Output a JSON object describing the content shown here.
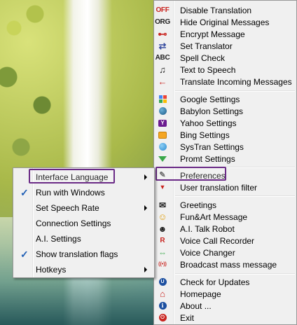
{
  "main_menu": {
    "group1": [
      {
        "label": "Disable Translation",
        "icon": "off-icon",
        "glyph": "OFF",
        "color": "#c9241f"
      },
      {
        "label": "Hide Original Messages",
        "icon": "org-icon",
        "glyph": "ORG",
        "color": "#222222"
      },
      {
        "label": "Encrypt Message",
        "icon": "key-icon",
        "glyph": "⊷",
        "color": "#c9241f"
      },
      {
        "label": "Set Translator",
        "icon": "swap-arrows-icon",
        "glyph": "⇄",
        "color": "#3a4fa0"
      },
      {
        "label": "Spell Check",
        "icon": "abc-icon",
        "glyph": "ABC",
        "color": "#222222"
      },
      {
        "label": "Text to Speech",
        "icon": "music-note-icon",
        "glyph": "♫",
        "color": "#222222"
      },
      {
        "label": "Translate Incoming Messages",
        "icon": "back-arrow-icon",
        "glyph": "←",
        "color": "#c9241f"
      }
    ],
    "group2": [
      {
        "label": "Google Settings",
        "icon": "google-icon",
        "color": "#4285f4"
      },
      {
        "label": "Babylon Settings",
        "icon": "babylon-icon",
        "color": "#1c5a86"
      },
      {
        "label": "Yahoo Settings",
        "icon": "yahoo-icon",
        "glyph": "Y",
        "color": "#6b1b8f"
      },
      {
        "label": "Bing Settings",
        "icon": "bing-icon",
        "color": "#f5a623"
      },
      {
        "label": "SysTran Settings",
        "icon": "systran-icon",
        "color": "#2a8ad0"
      },
      {
        "label": "Promt Settings",
        "icon": "promt-icon",
        "color": "#3aa84a"
      }
    ],
    "group3": [
      {
        "label": "Preferences",
        "icon": "wrench-icon",
        "glyph": "🔧",
        "color": "#555555"
      },
      {
        "label": "User translation filter",
        "icon": "filter-icon",
        "glyph": "▼",
        "color": "#c9241f"
      }
    ],
    "group4": [
      {
        "label": "Greetings",
        "icon": "envelope-icon",
        "glyph": "✉",
        "color": "#222222"
      },
      {
        "label": "Fun&Art Message",
        "icon": "smiley-icon",
        "glyph": "☺",
        "color": "#e0a010"
      },
      {
        "label": "A.I. Talk Robot",
        "icon": "robot-icon",
        "glyph": "☻",
        "color": "#333333"
      },
      {
        "label": "Voice Call Recorder",
        "icon": "record-icon",
        "glyph": "R",
        "color": "#c9241f"
      },
      {
        "label": "Voice Changer",
        "icon": "voice-changer-icon",
        "glyph": "⇔",
        "color": "#3aa84a"
      },
      {
        "label": "Broadcast mass message",
        "icon": "broadcast-icon",
        "glyph": "((•))",
        "color": "#c9241f"
      }
    ],
    "group5": [
      {
        "label": "Check for Updates",
        "icon": "update-icon",
        "glyph": "U",
        "color": "#1c4fa0"
      },
      {
        "label": "Homepage",
        "icon": "home-icon",
        "glyph": "⌂",
        "color": "#c9241f"
      },
      {
        "label": "About ...",
        "icon": "info-icon",
        "glyph": "i",
        "color": "#1c4fa0"
      },
      {
        "label": "Exit",
        "icon": "power-icon",
        "glyph": "⏻",
        "color": "#c9241f"
      }
    ]
  },
  "sub_menu": {
    "items": [
      {
        "label": "Interface Language",
        "has_submenu": true,
        "checked": false
      },
      {
        "label": "Run with Windows",
        "has_submenu": false,
        "checked": true
      },
      {
        "label": "Set Speech Rate",
        "has_submenu": true,
        "checked": false
      },
      {
        "label": "Connection Settings",
        "has_submenu": false,
        "checked": false
      },
      {
        "label": "A.I. Settings",
        "has_submenu": false,
        "checked": false
      },
      {
        "label": "Show translation flags",
        "has_submenu": false,
        "checked": true
      },
      {
        "label": "Hotkeys",
        "has_submenu": true,
        "checked": false
      }
    ],
    "check_glyph": "✓"
  },
  "colors": {
    "menu_bg": "#f0f0f0",
    "highlight_border": "#6a2a86",
    "check_color": "#1f5fb5"
  }
}
